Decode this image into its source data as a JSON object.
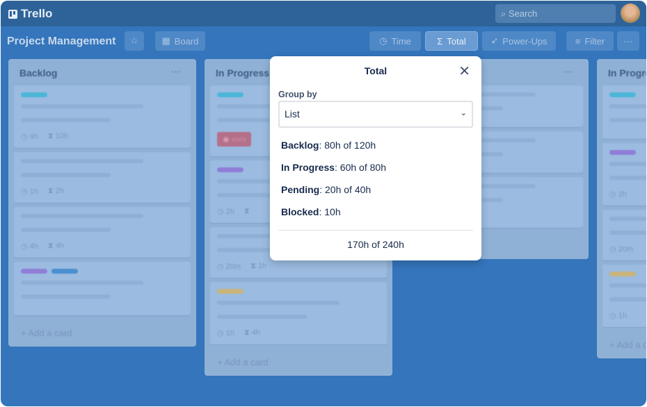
{
  "app": {
    "name": "Trello",
    "search_placeholder": "Search"
  },
  "board": {
    "title": "Project Management",
    "view": "Board",
    "buttons": {
      "time": "Time",
      "total": "Total",
      "powerups": "Power-Ups",
      "filter": "Filter",
      "more": "···"
    }
  },
  "lists": [
    {
      "title": "Backlog",
      "cards": [
        {
          "labels": [
            "#4bb6d8"
          ],
          "meta": [
            "4h",
            "10h"
          ]
        },
        {
          "labels": [],
          "meta": [
            "1h",
            "2h"
          ]
        },
        {
          "labels": [],
          "meta": [
            "4h",
            "4h"
          ]
        },
        {
          "labels": [
            "#8f7ed8",
            "#4a8fd0"
          ],
          "meta": []
        }
      ],
      "add": "Add a card"
    },
    {
      "title": "In Progress",
      "cards": [
        {
          "labels": [
            "#4bb6d8"
          ],
          "meta": [],
          "badge": true
        },
        {
          "labels": [
            "#8f7ed8"
          ],
          "meta": [
            "2h",
            ""
          ]
        },
        {
          "labels": [],
          "meta": [
            "20m",
            "1h"
          ]
        },
        {
          "labels": [
            "#c9b47a"
          ],
          "meta": [
            "1h",
            "4h"
          ]
        }
      ],
      "add": "Add a card"
    },
    {
      "title": "",
      "cards": [
        {
          "labels": [],
          "meta": []
        },
        {
          "labels": [],
          "meta": []
        },
        {
          "labels": [],
          "meta": [
            "6h",
            "7h"
          ]
        }
      ],
      "add": "Add a card"
    },
    {
      "title": "In Progress",
      "cards": [
        {
          "labels": [
            "#4bb6d8"
          ],
          "meta": []
        },
        {
          "labels": [
            "#8f7ed8"
          ],
          "meta": [
            "2h"
          ]
        },
        {
          "labels": [],
          "meta": [
            "20m"
          ]
        },
        {
          "labels": [
            "#c9b47a"
          ],
          "meta": [
            "1h"
          ]
        }
      ],
      "add": "Add a card"
    }
  ],
  "popup": {
    "title": "Total",
    "group_by_label": "Group by",
    "group_by_value": "List",
    "rows": [
      {
        "name": "Backlog",
        "value": ": 80h of 120h"
      },
      {
        "name": "In Progress",
        "value": ": 60h of 80h"
      },
      {
        "name": "Pending",
        "value": ": 20h of 40h"
      },
      {
        "name": "Blocked",
        "value": ": 10h"
      }
    ],
    "total": "170h of 240h"
  }
}
